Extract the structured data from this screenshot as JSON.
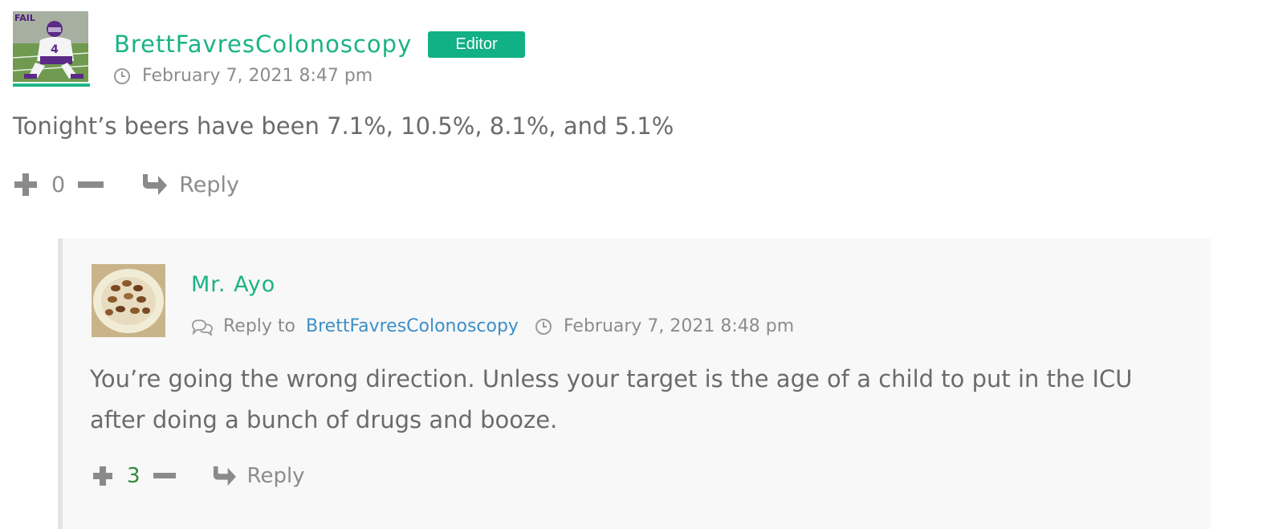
{
  "comment": {
    "author": "BrettFavresColonoscopy",
    "badge": "Editor",
    "date": "February 7, 2021 8:47 pm",
    "text": "Tonight’s beers have been 7.1%, 10.5%, 8.1%, and 5.1%",
    "vote_count": "0",
    "reply_label": "Reply",
    "avatar_caption": "FAIL",
    "avatar_jersey": "4"
  },
  "reply": {
    "author": "Mr. Ayo",
    "reply_to_label": "Reply to",
    "reply_to_author": "BrettFavresColonoscopy",
    "date": "February 7, 2021 8:48 pm",
    "text_line1": "You’re going the wrong direction. Unless your target is the age of a child to put in the ICU",
    "text_line2": "after doing a bunch of drugs and booze.",
    "vote_count": "3",
    "reply_label": "Reply"
  },
  "colors": {
    "accent_green": "#1ab384",
    "badge_bg": "#12b085",
    "link_blue": "#3b8fc9",
    "positive_count": "#2e8b3a"
  },
  "icons": {
    "clock": "clock-icon",
    "plus": "plus-icon",
    "minus": "minus-icon",
    "reply": "reply-arrow-icon",
    "comments": "comments-icon"
  }
}
